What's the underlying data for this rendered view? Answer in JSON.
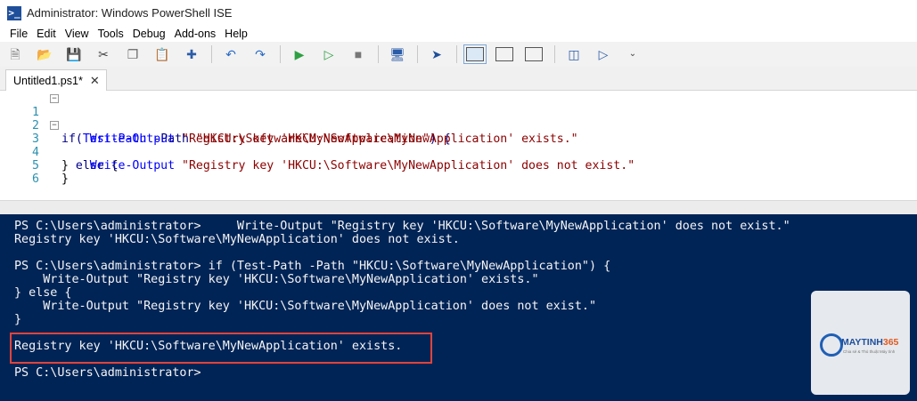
{
  "window": {
    "title": "Administrator: Windows PowerShell ISE",
    "accent": "#012456"
  },
  "menu": [
    "File",
    "Edit",
    "View",
    "Tools",
    "Debug",
    "Add-ons",
    "Help"
  ],
  "toolbar": {
    "icons": [
      "new-file-icon",
      "open-folder-icon",
      "save-icon",
      "cut-icon",
      "copy-icon",
      "paste-icon",
      "clear-icon",
      "undo-icon",
      "redo-icon",
      "run-icon",
      "run-selection-icon",
      "stop-icon",
      "remote-powershell-icon",
      "start-powershell-icon",
      "show-script-top-icon",
      "show-script-right-icon",
      "show-script-maximized-icon",
      "command-addon-icon",
      "show-command-window-icon"
    ]
  },
  "tab": {
    "label": "Untitled1.ps1*",
    "close": "✕"
  },
  "editor": {
    "line_numbers": [
      "1",
      "2",
      "3",
      "4",
      "5",
      "6"
    ],
    "lines": [
      [
        "if",
        "(",
        "Test-Path",
        " -Path ",
        "\"HKCU:\\Software\\MyNewApplication\"",
        ") {"
      ],
      [
        "    ",
        "Write-Output",
        " ",
        "\"Registry key 'HKCU:\\Software\\MyNewApplication' exists.\""
      ],
      [
        "} ",
        "else",
        " {"
      ],
      [
        "    ",
        "Write-Output",
        " ",
        "\"Registry key 'HKCU:\\Software\\MyNewApplication' does not exist.\""
      ],
      [
        "}"
      ]
    ]
  },
  "console": {
    "lines": [
      "PS C:\\Users\\administrator>     Write-Output \"Registry key 'HKCU:\\Software\\MyNewApplication' does not exist.\"",
      "Registry key 'HKCU:\\Software\\MyNewApplication' does not exist.",
      "",
      "PS C:\\Users\\administrator> if (Test-Path -Path \"HKCU:\\Software\\MyNewApplication\") {",
      "    Write-Output \"Registry key 'HKCU:\\Software\\MyNewApplication' exists.\"",
      "} else {",
      "    Write-Output \"Registry key 'HKCU:\\Software\\MyNewApplication' does not exist.\"",
      "}",
      "",
      "Registry key 'HKCU:\\Software\\MyNewApplication' exists.",
      "",
      "PS C:\\Users\\administrator>"
    ]
  },
  "watermark": {
    "brand_main": "MAYTINH",
    "brand_num": "365",
    "tagline": "Chia sẻ & Thủ thuật Máy tính"
  }
}
